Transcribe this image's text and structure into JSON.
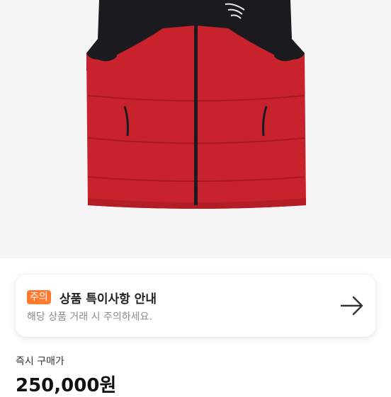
{
  "product": {
    "image": "red-black-puffer-vest",
    "brand_mark": "THE NORTH FACE"
  },
  "notice": {
    "badge": "주의",
    "title": "상품 특이사항 안내",
    "subtitle": "해당 상품 거래 시 주의하세요.",
    "arrow_icon": "arrow-right-icon",
    "badge_color": "#ff7a2f"
  },
  "price": {
    "label": "즉시 구매가",
    "value": "250,000원"
  }
}
